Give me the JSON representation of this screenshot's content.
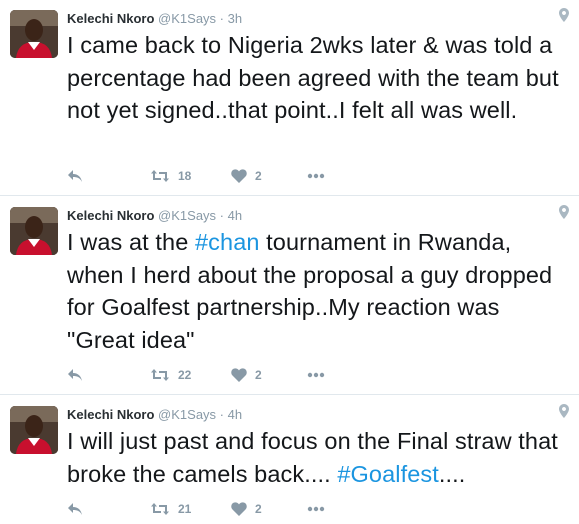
{
  "author": {
    "name": "Kelechi Nkoro",
    "handle": "@K1Says",
    "separator": "·"
  },
  "tweets": [
    {
      "time": "3h",
      "text_parts": [
        {
          "text": "I came back to Nigeria 2wks later & was told a percentage had been agreed with the team but not yet signed..that point..I felt all was well."
        }
      ],
      "retweets": "18",
      "likes": "2"
    },
    {
      "time": "4h",
      "text_parts": [
        {
          "text": "I was at the "
        },
        {
          "text": "#chan"
        },
        {
          "text": " tournament in Rwanda, when I herd about the proposal a guy dropped for Goalfest partnership..My reaction was \"Great idea\""
        }
      ],
      "retweets": "22",
      "likes": "2"
    },
    {
      "time": "4h",
      "text_parts": [
        {
          "text": "I will just past and focus on the Final straw that broke the camels back.... "
        },
        {
          "text": "#Goalfest"
        },
        {
          "text": "...."
        }
      ],
      "retweets": "21",
      "likes": "2"
    }
  ],
  "icons": {
    "reply": "reply-icon",
    "retweet": "retweet-icon",
    "like": "heart-icon",
    "more": "more-icon",
    "geo": "location-pin-icon"
  },
  "colors": {
    "hashtag": "#1b95e0",
    "meta": "#8899a6",
    "text": "#14171a"
  }
}
